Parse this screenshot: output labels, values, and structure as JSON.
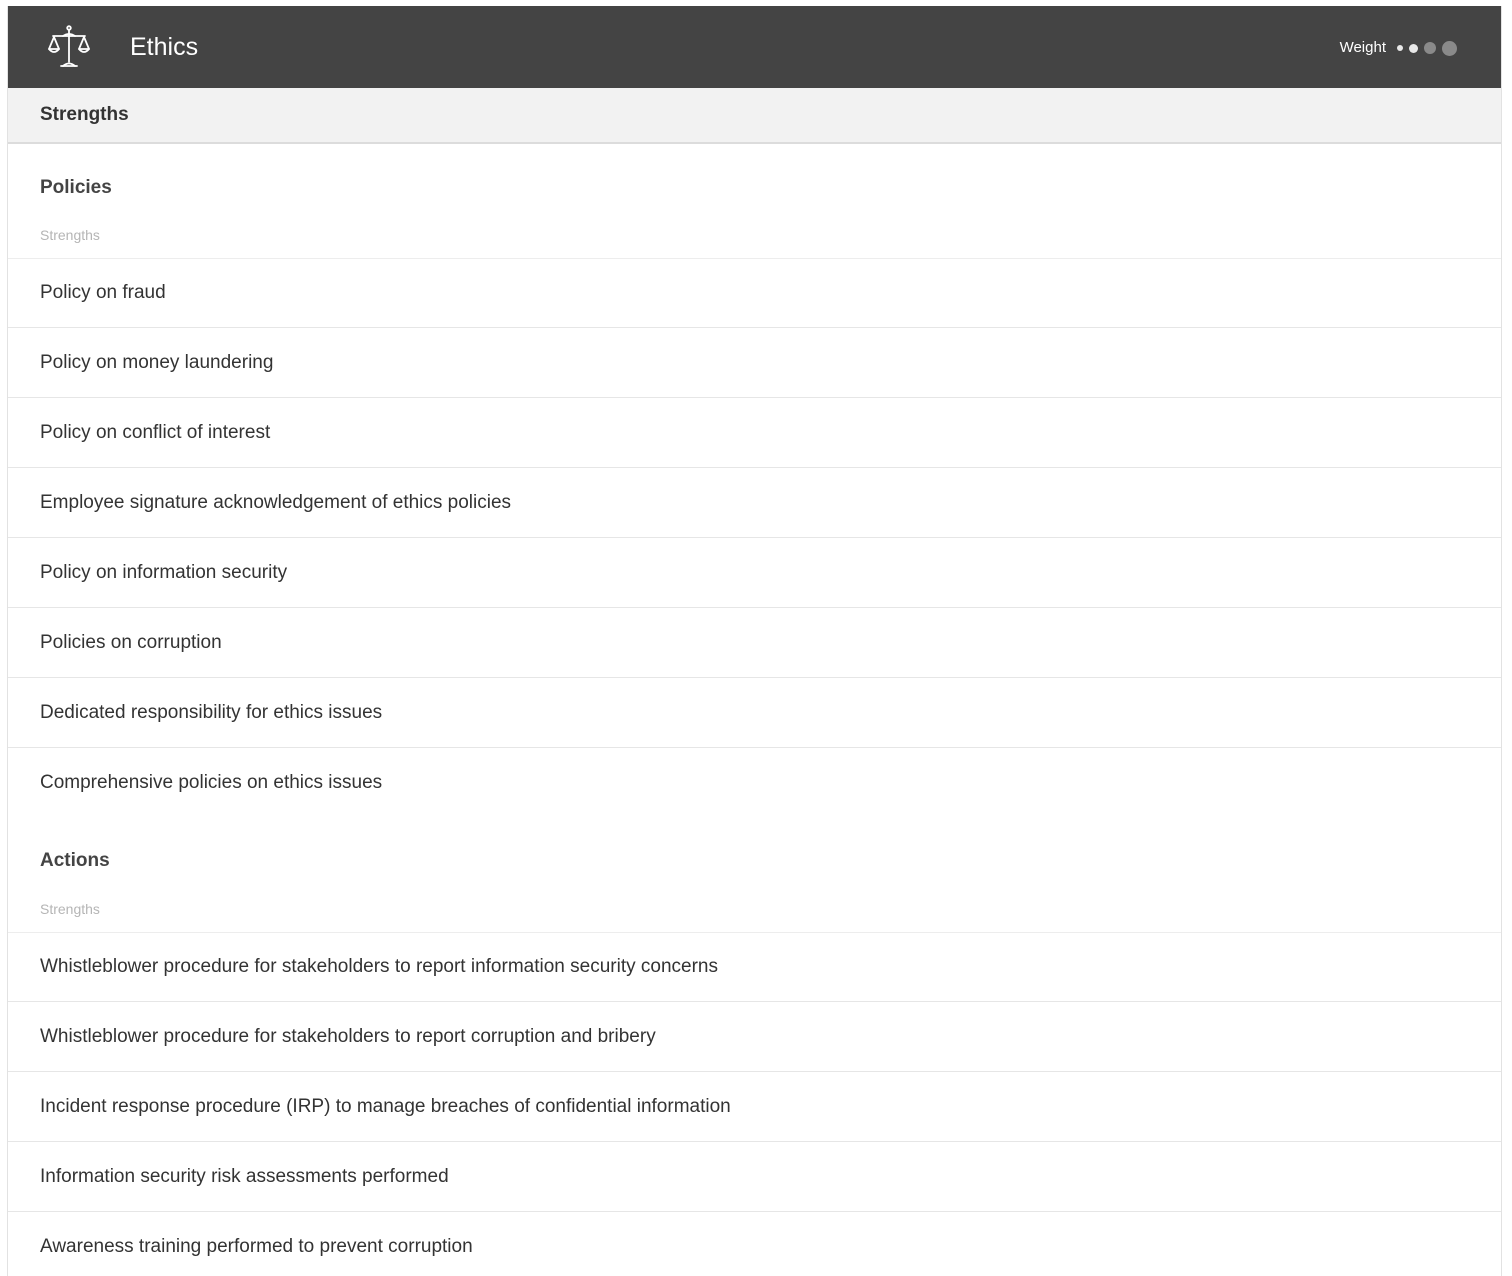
{
  "header": {
    "title": "Ethics",
    "icon": "scales-icon",
    "weight_label": "Weight",
    "weight_level": 2,
    "weight_max": 4
  },
  "section": {
    "title": "Strengths"
  },
  "groups": [
    {
      "title": "Policies",
      "subtitle": "Strengths",
      "items": [
        "Policy on fraud",
        "Policy on money laundering",
        "Policy on conflict of interest",
        "Employee signature acknowledgement of ethics policies",
        "Policy on information security",
        "Policies on corruption",
        "Dedicated responsibility for ethics issues",
        "Comprehensive policies on ethics issues"
      ]
    },
    {
      "title": "Actions",
      "subtitle": "Strengths",
      "items": [
        "Whistleblower procedure for stakeholders to report information security concerns",
        "Whistleblower procedure for stakeholders to report corruption and bribery",
        "Incident response procedure (IRP) to manage breaches of confidential information",
        "Information security risk assessments performed",
        "Awareness training performed to prevent corruption"
      ]
    }
  ],
  "colors": {
    "header_bg": "#444444",
    "section_bg": "#f2f2f2",
    "text": "#333333",
    "muted": "#b5b5b5"
  }
}
